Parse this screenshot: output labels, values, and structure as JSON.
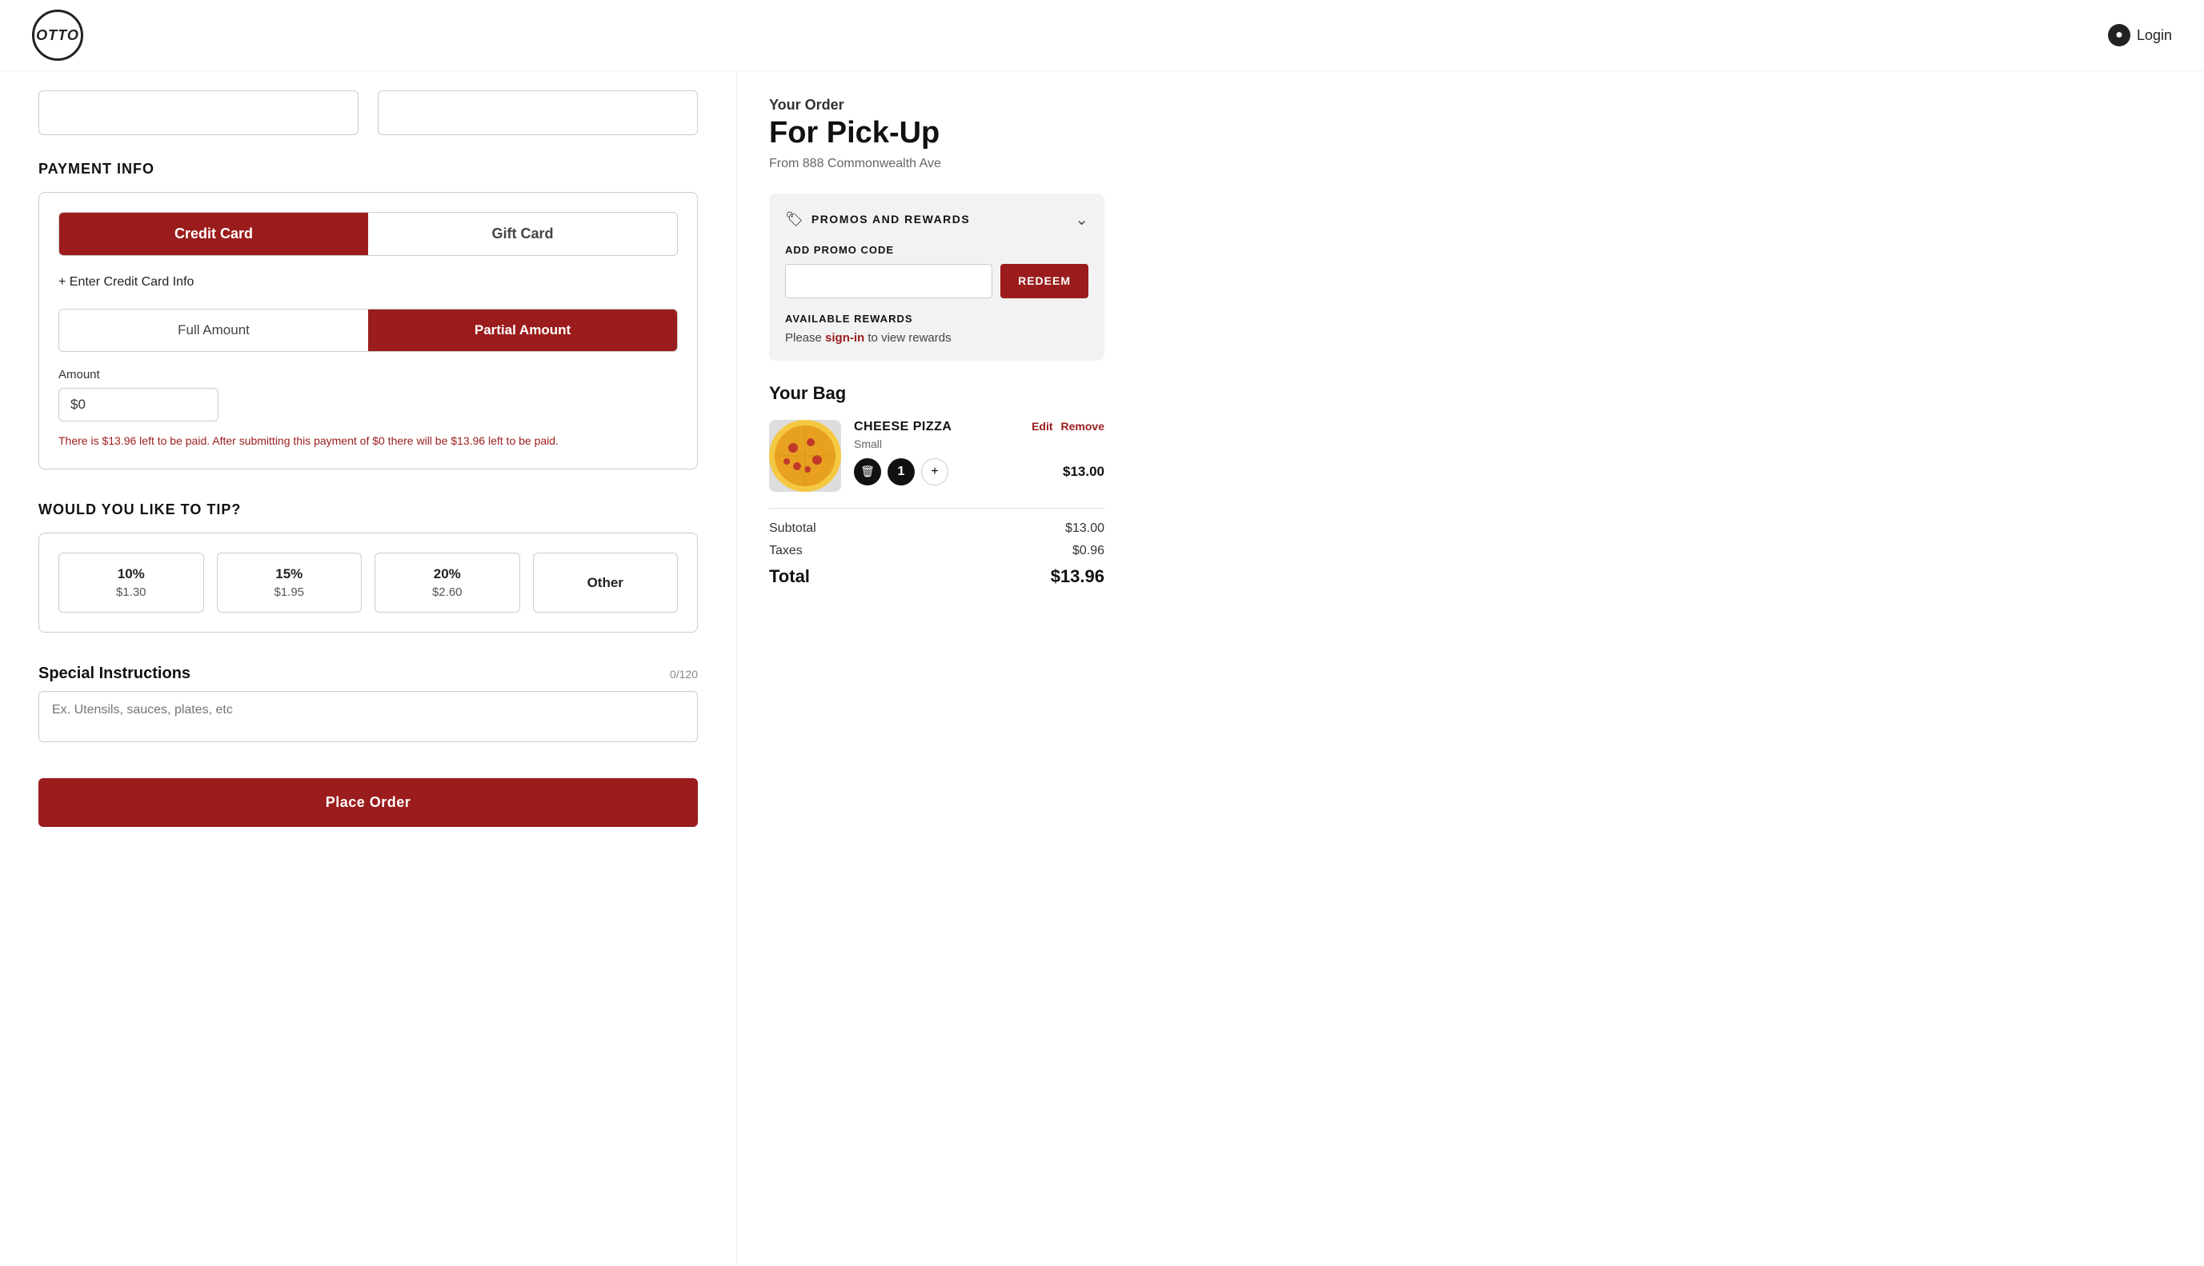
{
  "header": {
    "logo_text": "OTTO",
    "login_label": "Login"
  },
  "left": {
    "payment_section_heading": "PAYMENT INFO",
    "payment_tabs": [
      {
        "label": "Credit Card",
        "active": true
      },
      {
        "label": "Gift Card",
        "active": false
      }
    ],
    "enter_cc_label": "+ Enter Credit Card Info",
    "amount_toggle": [
      {
        "label": "Full Amount",
        "active": false
      },
      {
        "label": "Partial Amount",
        "active": true
      }
    ],
    "amount_label": "Amount",
    "amount_value": "$0",
    "amount_warning": "There is $13.96 left to be paid. After submitting this payment of $0 there will be $13.96 left to be paid.",
    "tip_heading": "WOULD YOU LIKE TO TIP?",
    "tip_options": [
      {
        "pct": "10%",
        "amt": "$1.30"
      },
      {
        "pct": "15%",
        "amt": "$1.95"
      },
      {
        "pct": "20%",
        "amt": "$2.60"
      },
      {
        "pct": "Other",
        "amt": ""
      }
    ],
    "special_instructions_heading": "Special Instructions",
    "special_instructions_char_count": "0/120",
    "special_instructions_placeholder": "Ex. Utensils, sauces, plates, etc",
    "submit_label": "Place Order"
  },
  "right": {
    "order_label": "Your Order",
    "order_type": "For Pick-Up",
    "order_address": "From 888 Commonwealth Ave",
    "promos_title": "PROMOS AND REWARDS",
    "add_promo_label": "ADD PROMO CODE",
    "promo_placeholder": "",
    "redeem_label": "REDEEM",
    "available_rewards_label": "AVAILABLE REWARDS",
    "rewards_text_before": "Please ",
    "rewards_sign_in": "sign-in",
    "rewards_text_after": " to view rewards",
    "bag_heading": "Your Bag",
    "bag_items": [
      {
        "name": "CHEESE PIZZA",
        "size": "Small",
        "quantity": 1,
        "price": "$13.00",
        "edit_label": "Edit",
        "remove_label": "Remove"
      }
    ],
    "subtotal_label": "Subtotal",
    "subtotal_value": "$13.00",
    "taxes_label": "Taxes",
    "taxes_value": "$0.96",
    "total_label": "Total",
    "total_value": "$13.96"
  }
}
